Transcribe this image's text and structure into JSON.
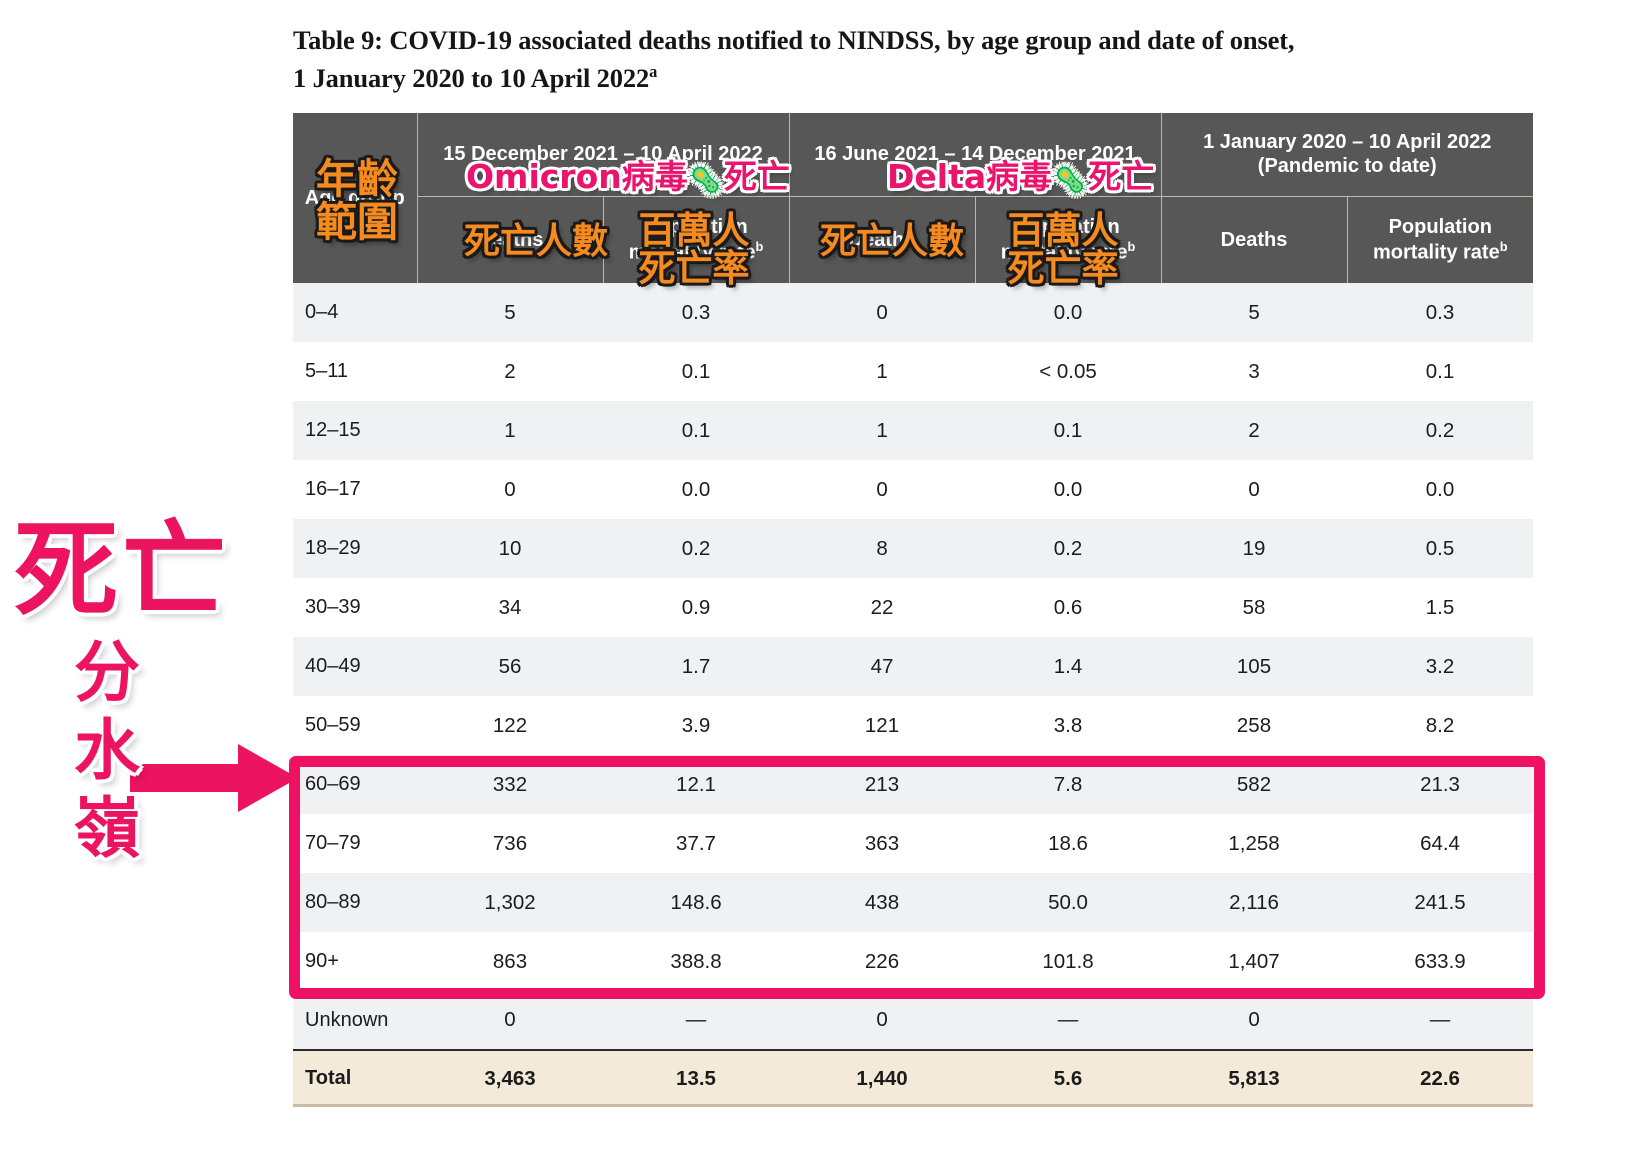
{
  "caption": {
    "line1": "Table 9: COVID-19 associated deaths notified to NINDSS, by age group and date of onset,",
    "line2": "1 January 2020 to 10 April 2022",
    "superscript": "a"
  },
  "table": {
    "header": {
      "age_col_english": "Age group",
      "groups": [
        {
          "period": "15 December 2021 – 10 April 2022",
          "subtitle": ""
        },
        {
          "period": "16 June 2021 – 14 December 2021",
          "subtitle": ""
        },
        {
          "period": "1 January 2020 – 10 April 2022",
          "subtitle": "(Pandemic to date)"
        }
      ],
      "subheaders": [
        {
          "label": "Deaths",
          "sup": ""
        },
        {
          "label": "Population mortality rate",
          "sup": "b"
        },
        {
          "label": "Deaths",
          "sup": ""
        },
        {
          "label": "Population mortality rate",
          "sup": "b"
        },
        {
          "label": "Deaths",
          "sup": ""
        },
        {
          "label": "Population mortality rate",
          "sup": "b"
        }
      ]
    },
    "rows": [
      {
        "age": "0–4",
        "omicron_deaths": "5",
        "omicron_rate": "0.3",
        "delta_deaths": "0",
        "delta_rate": "0.0",
        "total_deaths": "5",
        "total_rate": "0.3",
        "highlighted": false
      },
      {
        "age": "5–11",
        "omicron_deaths": "2",
        "omicron_rate": "0.1",
        "delta_deaths": "1",
        "delta_rate": "< 0.05",
        "total_deaths": "3",
        "total_rate": "0.1",
        "highlighted": false
      },
      {
        "age": "12–15",
        "omicron_deaths": "1",
        "omicron_rate": "0.1",
        "delta_deaths": "1",
        "delta_rate": "0.1",
        "total_deaths": "2",
        "total_rate": "0.2",
        "highlighted": false
      },
      {
        "age": "16–17",
        "omicron_deaths": "0",
        "omicron_rate": "0.0",
        "delta_deaths": "0",
        "delta_rate": "0.0",
        "total_deaths": "0",
        "total_rate": "0.0",
        "highlighted": false
      },
      {
        "age": "18–29",
        "omicron_deaths": "10",
        "omicron_rate": "0.2",
        "delta_deaths": "8",
        "delta_rate": "0.2",
        "total_deaths": "19",
        "total_rate": "0.5",
        "highlighted": false
      },
      {
        "age": "30–39",
        "omicron_deaths": "34",
        "omicron_rate": "0.9",
        "delta_deaths": "22",
        "delta_rate": "0.6",
        "total_deaths": "58",
        "total_rate": "1.5",
        "highlighted": false
      },
      {
        "age": "40–49",
        "omicron_deaths": "56",
        "omicron_rate": "1.7",
        "delta_deaths": "47",
        "delta_rate": "1.4",
        "total_deaths": "105",
        "total_rate": "3.2",
        "highlighted": false
      },
      {
        "age": "50–59",
        "omicron_deaths": "122",
        "omicron_rate": "3.9",
        "delta_deaths": "121",
        "delta_rate": "3.8",
        "total_deaths": "258",
        "total_rate": "8.2",
        "highlighted": false
      },
      {
        "age": "60–69",
        "omicron_deaths": "332",
        "omicron_rate": "12.1",
        "delta_deaths": "213",
        "delta_rate": "7.8",
        "total_deaths": "582",
        "total_rate": "21.3",
        "highlighted": true
      },
      {
        "age": "70–79",
        "omicron_deaths": "736",
        "omicron_rate": "37.7",
        "delta_deaths": "363",
        "delta_rate": "18.6",
        "total_deaths": "1,258",
        "total_rate": "64.4",
        "highlighted": true
      },
      {
        "age": "80–89",
        "omicron_deaths": "1,302",
        "omicron_rate": "148.6",
        "delta_deaths": "438",
        "delta_rate": "50.0",
        "total_deaths": "2,116",
        "total_rate": "241.5",
        "highlighted": true
      },
      {
        "age": "90+",
        "omicron_deaths": "863",
        "omicron_rate": "388.8",
        "delta_deaths": "226",
        "delta_rate": "101.8",
        "total_deaths": "1,407",
        "total_rate": "633.9",
        "highlighted": true
      },
      {
        "age": "Unknown",
        "omicron_deaths": "0",
        "omicron_rate": "—",
        "delta_deaths": "0",
        "delta_rate": "—",
        "total_deaths": "0",
        "total_rate": "—",
        "highlighted": false
      }
    ],
    "total_row": {
      "age": "Total",
      "omicron_deaths": "3,463",
      "omicron_rate": "13.5",
      "delta_deaths": "1,440",
      "delta_rate": "5.6",
      "total_deaths": "5,813",
      "total_rate": "22.6"
    }
  },
  "annotations": {
    "age_range": "年齡\n範圍",
    "omicron_title": "Omicron病毒",
    "omicron_title_tail": "死亡",
    "delta_title": "Delta病毒",
    "delta_title_tail": "死亡",
    "virus_emoji": "🦠",
    "omicron_deaths_label": "死亡人數",
    "omicron_rate_label": "百萬人死亡率",
    "delta_deaths_label": "死亡人數",
    "delta_rate_label": "百萬人死亡率",
    "watershed_big": "死亡",
    "watershed_c1": "分",
    "watershed_c2": "水",
    "watershed_c3": "嶺"
  },
  "colors": {
    "header_bg": "#575757",
    "header_divider": "#c7b79a",
    "row_alt": "#f0f1f3",
    "total_bg": "#f3ead9",
    "highlight_pink": "#ef1264",
    "annotation_orange": "#f58a1f",
    "annotation_pink": "#e9156d",
    "annotation_crimson": "#ec1360"
  }
}
